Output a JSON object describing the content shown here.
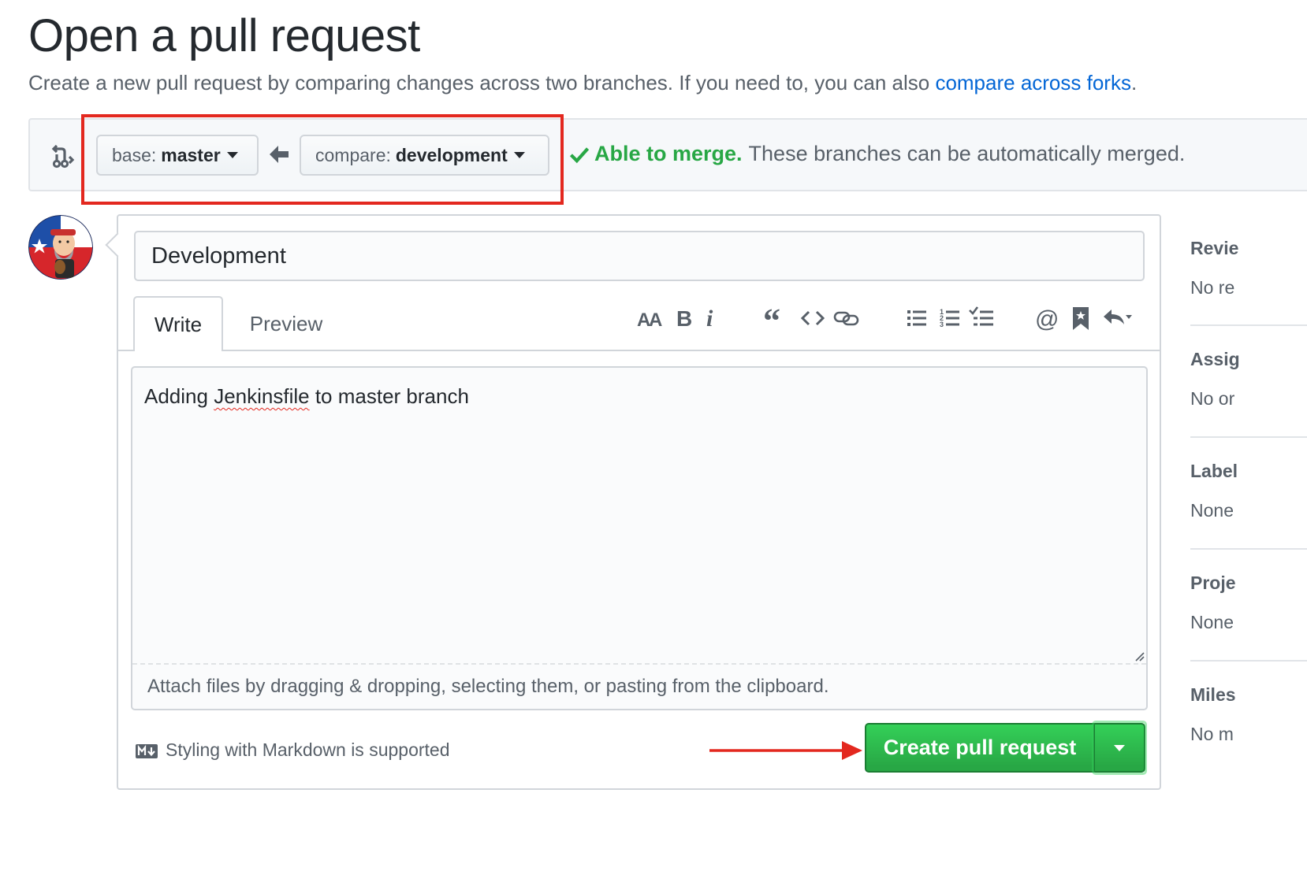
{
  "header": {
    "title": "Open a pull request",
    "subtitle_prefix": "Create a new pull request by comparing changes across two branches. If you need to, you can also ",
    "subtitle_link": "compare across forks",
    "subtitle_suffix": "."
  },
  "range": {
    "base_prefix": "base:",
    "base_branch": "master",
    "compare_prefix": "compare:",
    "compare_branch": "development",
    "merge_status": "Able to merge.",
    "merge_detail": "These branches can be automatically merged."
  },
  "form": {
    "title_value": "Development",
    "tabs": [
      "Write",
      "Preview"
    ],
    "body_word1": "Adding ",
    "body_spell": "Jenkinsfile",
    "body_rest": " to master branch",
    "attach_hint": "Attach files by dragging & dropping, selecting them, or pasting from the clipboard.",
    "markdown_note": "Styling with Markdown is supported",
    "submit_label": "Create pull request"
  },
  "toolbar": {
    "icons": [
      "header-icon",
      "bold-icon",
      "italic-icon",
      "quote-icon",
      "code-icon",
      "link-icon",
      "unordered-list-icon",
      "ordered-list-icon",
      "task-list-icon",
      "mention-icon",
      "bookmark-icon",
      "reply-icon"
    ]
  },
  "sidebar": {
    "sections": [
      {
        "heading": "Revie",
        "value": "No re"
      },
      {
        "heading": "Assig",
        "value": "No or"
      },
      {
        "heading": "Label",
        "value": "None"
      },
      {
        "heading": "Proje",
        "value": "None"
      },
      {
        "heading": "Miles",
        "value": "No m"
      }
    ]
  },
  "colors": {
    "link": "#0366d6",
    "success": "#28a745",
    "highlight": "#e3281f"
  }
}
